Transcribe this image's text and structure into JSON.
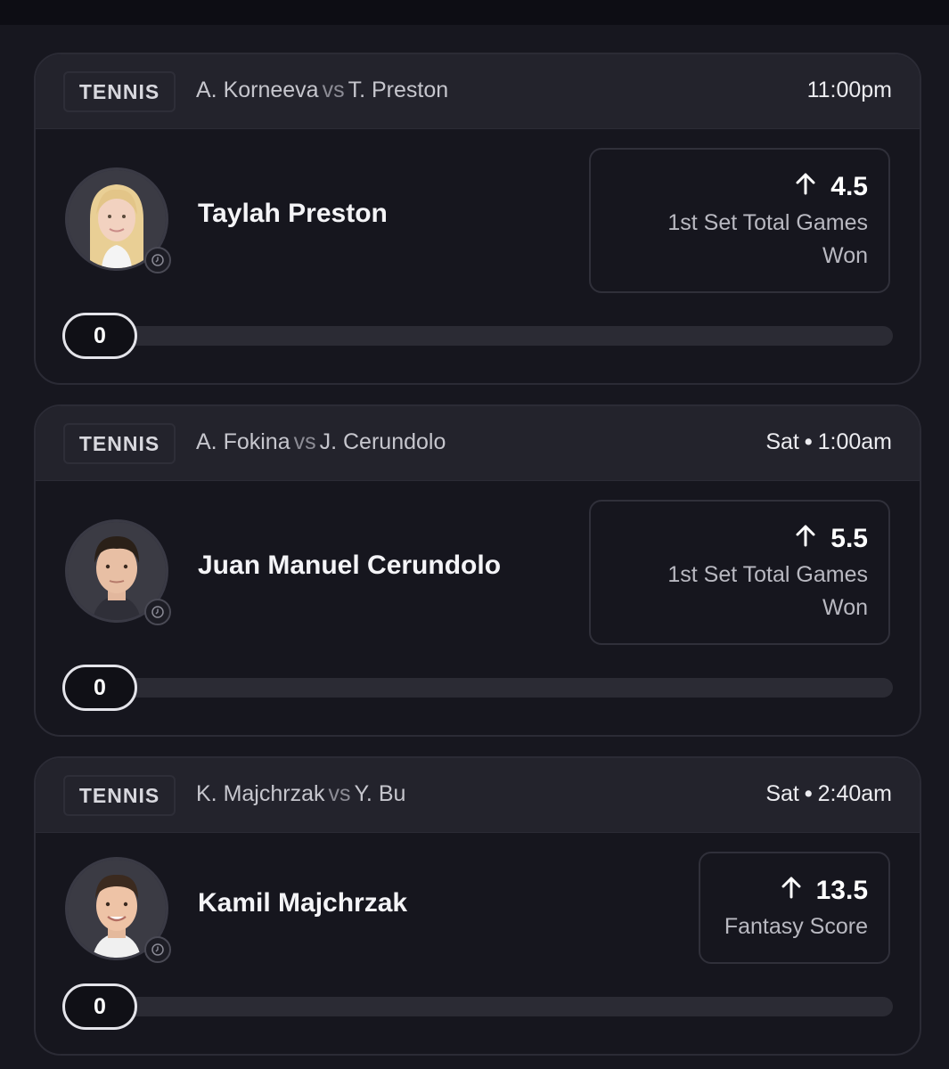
{
  "cards": [
    {
      "sport": "TENNIS",
      "player1": "A. Korneeva",
      "vs": "vs",
      "player2": "T. Preston",
      "time": "11:00pm",
      "day": "",
      "player_name": "Taylah Preston",
      "line": "4.5",
      "stat_line1": "1st Set Total Games",
      "stat_line2": "Won",
      "current": "0",
      "direction_icon": "arrow-up-icon"
    },
    {
      "sport": "TENNIS",
      "player1": "A. Fokina",
      "vs": "vs",
      "player2": "J. Cerundolo",
      "time": "1:00am",
      "day": "Sat",
      "player_name": "Juan Manuel Cerundolo",
      "line": "5.5",
      "stat_line1": "1st Set Total Games",
      "stat_line2": "Won",
      "current": "0",
      "direction_icon": "arrow-up-icon"
    },
    {
      "sport": "TENNIS",
      "player1": "K. Majchrzak",
      "vs": "vs",
      "player2": "Y. Bu",
      "time": "2:40am",
      "day": "Sat",
      "player_name": "Kamil Majchrzak",
      "line": "13.5",
      "stat_line1": "Fantasy Score",
      "stat_line2": "",
      "current": "0",
      "direction_icon": "arrow-up-icon"
    }
  ],
  "day_separator": "•",
  "colors": {
    "background": "#17171f",
    "card_header": "#23232c",
    "border": "#2b2b35",
    "text": "#ffffff",
    "muted_text": "#b9b9c1"
  }
}
